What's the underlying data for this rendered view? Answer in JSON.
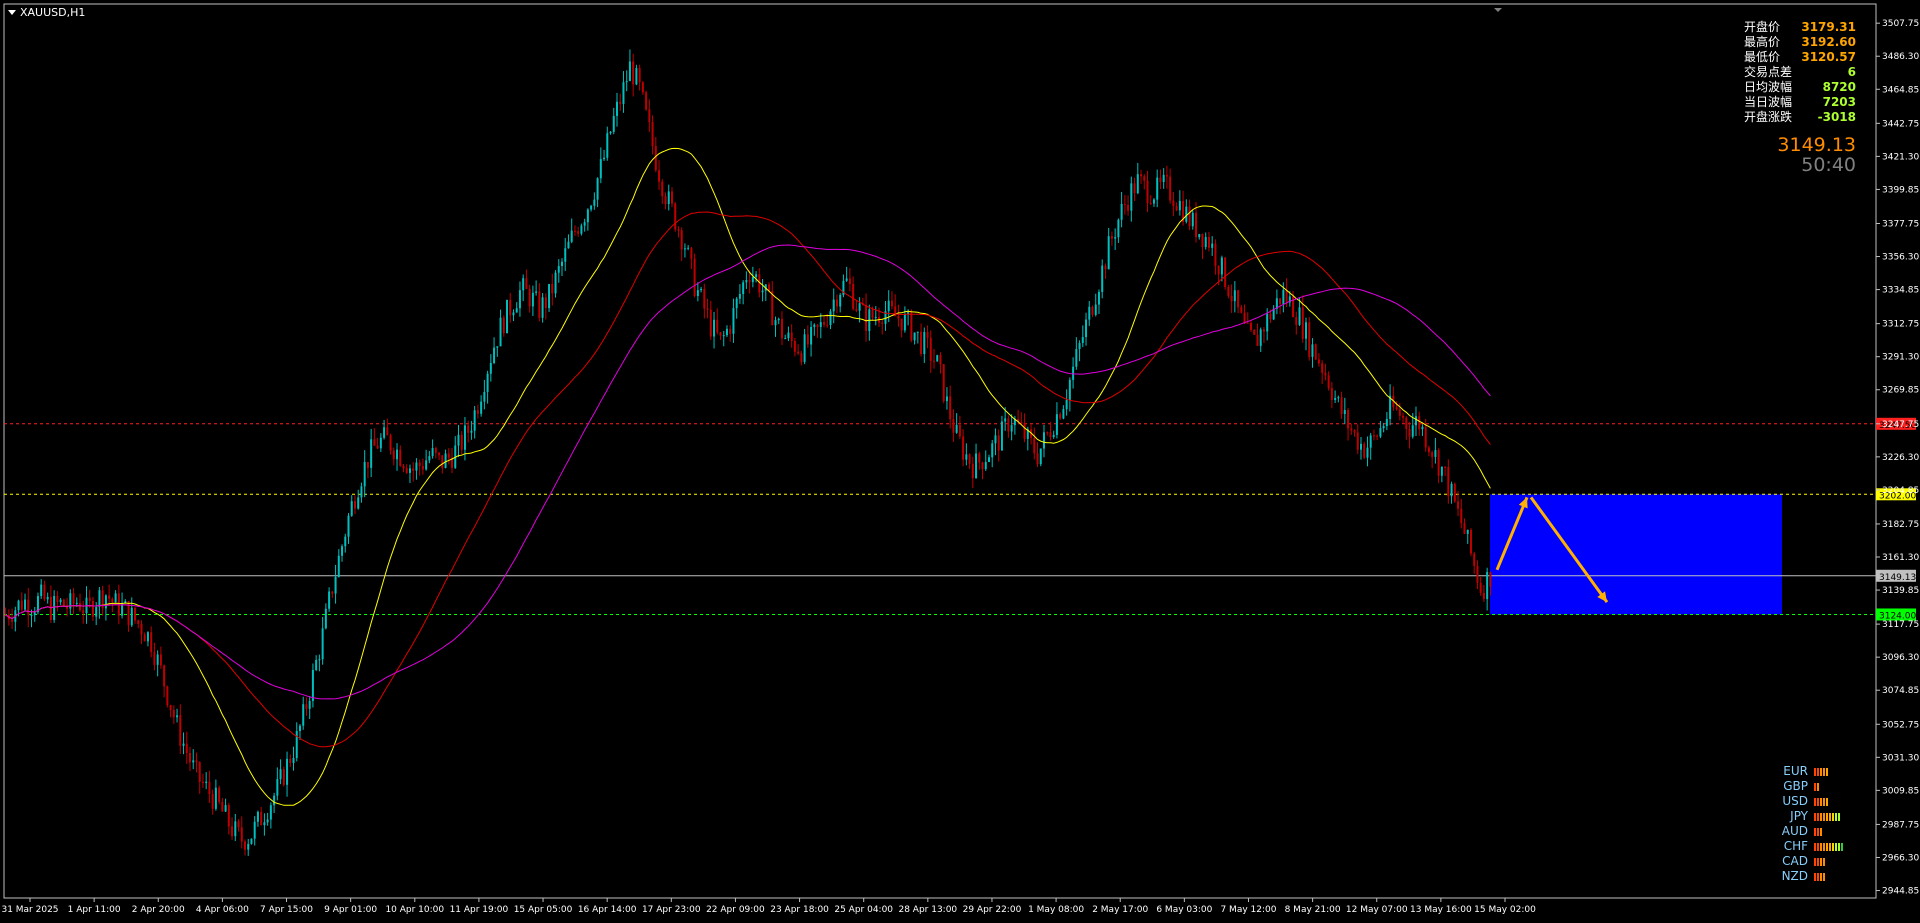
{
  "symbol": "XAUUSD,H1",
  "info_panel": [
    {
      "label": "开盘价",
      "value": "3179.31",
      "color": "#ffa500"
    },
    {
      "label": "最高价",
      "value": "3192.60",
      "color": "#ffa500"
    },
    {
      "label": "最低价",
      "value": "3120.57",
      "color": "#ffa500"
    },
    {
      "label": "交易点差",
      "value": "6",
      "color": "#adff2f"
    },
    {
      "label": "日均波幅",
      "value": "8720",
      "color": "#adff2f"
    },
    {
      "label": "当日波幅",
      "value": "7203",
      "color": "#adff2f"
    },
    {
      "label": "开盘涨跌",
      "value": "-3018",
      "color": "#adff2f"
    }
  ],
  "current_price": "3149.13",
  "countdown": "50:40",
  "currency_strength": [
    {
      "currency": "EUR",
      "level": 5,
      "colors": [
        "#ff4500",
        "#ff4500",
        "#ff8c00",
        "#ff8c00",
        "#ffa500"
      ]
    },
    {
      "currency": "GBP",
      "level": 2,
      "colors": [
        "#ff4500",
        "#ff8c00"
      ]
    },
    {
      "currency": "USD",
      "level": 5,
      "colors": [
        "#ff4500",
        "#ff4500",
        "#ff8c00",
        "#ff8c00",
        "#ffa500"
      ]
    },
    {
      "currency": "JPY",
      "level": 9,
      "colors": [
        "#ff4500",
        "#ff4500",
        "#ff8c00",
        "#ff8c00",
        "#ffa500",
        "#ffa500",
        "#ffd700",
        "#adff2f",
        "#adff2f"
      ]
    },
    {
      "currency": "AUD",
      "level": 3,
      "colors": [
        "#ff4500",
        "#ff4500",
        "#ff8c00"
      ]
    },
    {
      "currency": "CHF",
      "level": 10,
      "colors": [
        "#ff4500",
        "#ff4500",
        "#ff8c00",
        "#ff8c00",
        "#ffa500",
        "#ffa500",
        "#ffd700",
        "#adff2f",
        "#adff2f",
        "#32cd32"
      ]
    },
    {
      "currency": "CAD",
      "level": 4,
      "colors": [
        "#ff4500",
        "#ff4500",
        "#ff8c00",
        "#ff8c00"
      ]
    },
    {
      "currency": "NZD",
      "level": 4,
      "colors": [
        "#ff4500",
        "#ff4500",
        "#ff8c00",
        "#ff8c00"
      ]
    }
  ],
  "chart_data": {
    "type": "candlestick",
    "timeframe": "H1",
    "y_axis_ticks": [
      "3507.75",
      "3486.30",
      "3464.85",
      "3442.75",
      "3421.30",
      "3399.85",
      "3377.75",
      "3356.30",
      "3334.85",
      "3312.75",
      "3291.30",
      "3269.85",
      "3247.75",
      "3226.30",
      "3204.85",
      "3182.75",
      "3161.30",
      "3139.85",
      "3117.75",
      "3096.30",
      "3074.85",
      "3052.75",
      "3031.30",
      "3009.85",
      "2987.75",
      "2966.30",
      "2944.85"
    ],
    "ylim": [
      2940,
      3515
    ],
    "x_axis_labels": [
      "31 Mar 2025",
      "1 Apr 11:00",
      "2 Apr 20:00",
      "4 Apr 06:00",
      "7 Apr 15:00",
      "9 Apr 01:00",
      "10 Apr 10:00",
      "11 Apr 19:00",
      "15 Apr 05:00",
      "16 Apr 14:00",
      "17 Apr 23:00",
      "22 Apr 09:00",
      "23 Apr 18:00",
      "25 Apr 04:00",
      "28 Apr 13:00",
      "29 Apr 22:00",
      "1 May 08:00",
      "2 May 17:00",
      "6 May 03:00",
      "7 May 12:00",
      "8 May 21:00",
      "12 May 07:00",
      "13 May 16:00",
      "15 May 02:00"
    ],
    "close_path": [
      3124,
      3128,
      3133,
      3130,
      3135,
      3128,
      3131,
      3129,
      3133,
      3126,
      3134,
      3138,
      3131,
      3128,
      3122,
      3116,
      3108,
      3090,
      3070,
      3050,
      3035,
      3020,
      3012,
      3005,
      2995,
      2985,
      2978,
      2980,
      2990,
      3000,
      3010,
      3025,
      3040,
      3060,
      3085,
      3110,
      3140,
      3165,
      3190,
      3210,
      3225,
      3235,
      3238,
      3232,
      3225,
      3218,
      3222,
      3228,
      3222,
      3226,
      3232,
      3242,
      3258,
      3280,
      3300,
      3315,
      3326,
      3335,
      3330,
      3322,
      3330,
      3345,
      3360,
      3375,
      3385,
      3400,
      3418,
      3442,
      3460,
      3480,
      3465,
      3440,
      3415,
      3395,
      3380,
      3365,
      3340,
      3325,
      3310,
      3300,
      3312,
      3330,
      3348,
      3342,
      3330,
      3316,
      3304,
      3300,
      3296,
      3302,
      3310,
      3322,
      3335,
      3340,
      3325,
      3315,
      3318,
      3322,
      3318,
      3316,
      3310,
      3302,
      3295,
      3285,
      3260,
      3240,
      3228,
      3220,
      3226,
      3232,
      3240,
      3252,
      3245,
      3236,
      3228,
      3240,
      3252,
      3265,
      3285,
      3305,
      3325,
      3345,
      3365,
      3382,
      3395,
      3405,
      3400,
      3398,
      3402,
      3396,
      3388,
      3378,
      3372,
      3366,
      3352,
      3338,
      3322,
      3306,
      3300,
      3312,
      3322,
      3332,
      3326,
      3316,
      3300,
      3290,
      3278,
      3262,
      3250,
      3240,
      3232,
      3236,
      3246,
      3258,
      3254,
      3246,
      3250,
      3238,
      3226,
      3214,
      3196,
      3180,
      3160,
      3140,
      3150
    ],
    "sma_periods": {
      "fast_yellow": 10,
      "mid_red": 20,
      "slow_magenta": 30
    },
    "horizontal_levels": [
      {
        "value": 3247.75,
        "label": "3247.50",
        "color": "#ff2020",
        "style": "dotted"
      },
      {
        "value": 3202.0,
        "label": "3202.00",
        "color": "#ffff00",
        "style": "dotted"
      },
      {
        "value": 3149.13,
        "label": "3149.13",
        "color": "#c0c0c0",
        "style": "solid"
      },
      {
        "value": 3124.0,
        "label": "3124.00",
        "color": "#00ff00",
        "style": "dotted"
      }
    ],
    "zone": {
      "top": 3202.0,
      "bottom": 3124.0,
      "color": "#0000ff"
    },
    "forecast_arrows": [
      {
        "from": 3153,
        "to": 3200
      },
      {
        "from": 3200,
        "to": 3132
      }
    ],
    "grid": false
  }
}
